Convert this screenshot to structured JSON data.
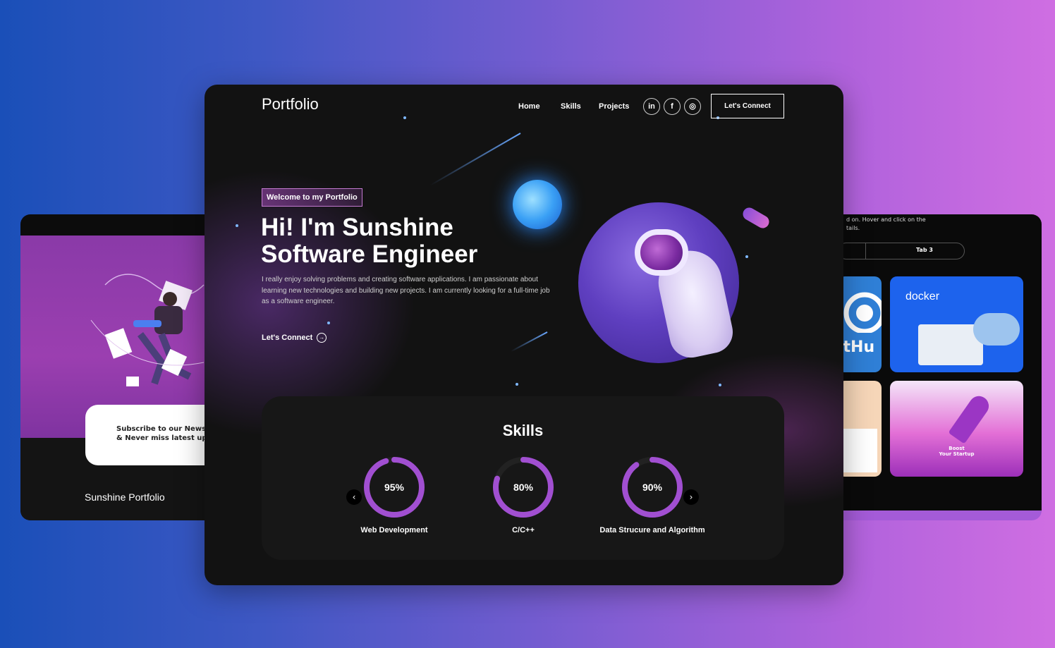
{
  "left_preview": {
    "newsletter_line1": "Subscribe to our Newslett",
    "newsletter_line2": "& Never miss latest upda",
    "footer_title": "Sunshine Portfolio"
  },
  "right_preview": {
    "hint_line1": "d on. Hover and click on the",
    "hint_line2": "tails.",
    "tab3_label": "Tab 3",
    "github_text": "itHu",
    "docker_text": "docker",
    "startup_line1": "Boost",
    "startup_line2": "Your Startup"
  },
  "header": {
    "logo": "Portfolio",
    "nav": [
      "Home",
      "Skills",
      "Projects"
    ],
    "social": [
      {
        "icon": "linkedin-icon",
        "glyph": "in"
      },
      {
        "icon": "facebook-icon",
        "glyph": "f"
      },
      {
        "icon": "github-icon",
        "glyph": "◎"
      }
    ],
    "cta": "Let's Connect"
  },
  "hero": {
    "badge": "Welcome to my Portfolio",
    "headline_line1": "Hi! I'm Sunshine",
    "headline_line2": "Software Engineer",
    "intro": "I really enjoy solving problems and creating software applications. I am passionate about learning new technologies and building new projects. I am currently looking for a full-time job as a software engineer.",
    "link": "Let's Connect",
    "link_arrow": "→"
  },
  "skills": {
    "title": "Skills",
    "prev_arrow": "‹",
    "next_arrow": "›",
    "items": [
      {
        "label": "Web Development",
        "percent_text": "95%",
        "percent": 95
      },
      {
        "label": "C/C++",
        "percent_text": "80%",
        "percent": 80
      },
      {
        "label": "Data Strucure and Algorithm",
        "percent_text": "90%",
        "percent": 90
      }
    ]
  },
  "colors": {
    "accent": "#a14fd1",
    "ring_start": "#6a2bbf",
    "ring_end": "#b43fa8"
  }
}
